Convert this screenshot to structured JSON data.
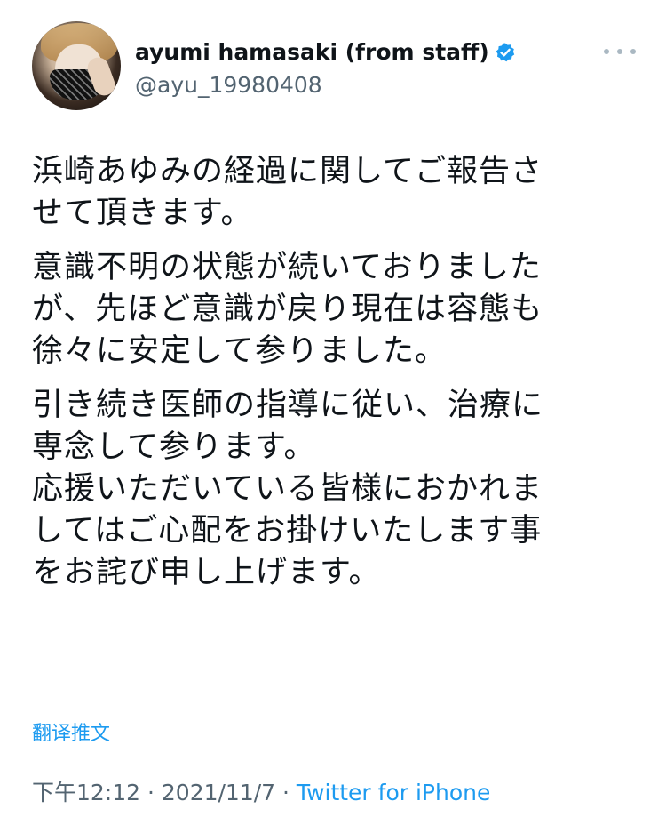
{
  "author": {
    "display_name": "ayumi hamasaki (from staff)",
    "handle": "@ayu_19980408",
    "verified": true,
    "avatar_icon": "profile-photo"
  },
  "more_menu": {
    "icon": "more-horizontal-icon"
  },
  "tweet": {
    "paragraphs": [
      "浜崎あゆみの経過に関してご報告さ\nせて頂きます。",
      "意識不明の状態が続いておりました\nが、先ほど意識が戻り現在は容態も\n徐々に安定して参りました。",
      "引き続き医師の指導に従い、治療に\n専念して参ります。\n応援いただいている皆様におかれま\nしてはご心配をお掛けいたします事\nをお詫び申し上げます。"
    ],
    "translate_label": "翻译推文",
    "time": "下午12:12",
    "separator": " · ",
    "date": "2021/11/7",
    "source": "Twitter for iPhone"
  },
  "colors": {
    "text": "#0f1419",
    "secondary": "#536471",
    "accent": "#1d9bf0"
  }
}
